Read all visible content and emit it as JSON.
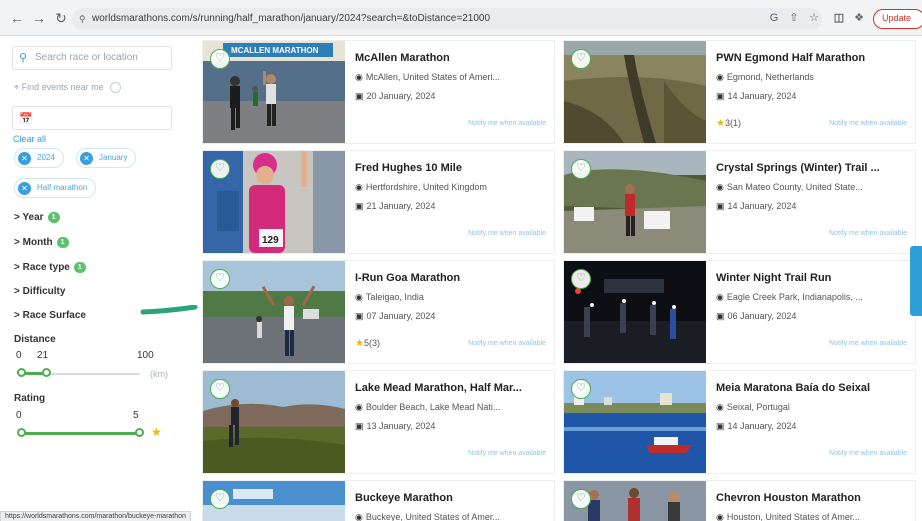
{
  "browser": {
    "url": "worldsmarathons.com/s/running/half_marathon/january/2024?search=&toDistance=21000",
    "update_label": "Update",
    "status_url": "https://worldsmarathons.com/marathon/buckeye-marathon"
  },
  "sidebar": {
    "search_placeholder": "Search race or location",
    "near_me_label": "Find events near me",
    "clear_all": "Clear all",
    "chips": [
      "2024",
      "January",
      "Half marathon"
    ],
    "facets": [
      {
        "label": "Year",
        "badge": "1"
      },
      {
        "label": "Month",
        "badge": "1"
      },
      {
        "label": "Race type",
        "badge": "1"
      },
      {
        "label": "Difficulty",
        "badge": ""
      },
      {
        "label": "Race Surface",
        "badge": ""
      }
    ],
    "distance": {
      "title": "Distance",
      "min": "0",
      "value": "21",
      "max": "100",
      "unit": "(km)",
      "fill_fraction": 0.21
    },
    "rating": {
      "title": "Rating",
      "min": "0",
      "max": "5",
      "low_fraction": 0.0,
      "high_fraction": 1.0
    }
  },
  "cards": [
    {
      "title": "McAllen Marathon",
      "location": "McAllen, United States of Ameri...",
      "date": "20 January, 2024",
      "rating": "",
      "notify": "Notify me when available"
    },
    {
      "title": "PWN Egmond Half Marathon",
      "location": "Egmond, Netherlands",
      "date": "14 January, 2024",
      "rating": "3(1)",
      "notify": "Notify me when available"
    },
    {
      "title": "Fred Hughes 10 Mile",
      "location": "Hertfordshire, United Kingdom",
      "date": "21 January, 2024",
      "rating": "",
      "notify": "Notify me when available"
    },
    {
      "title": "Crystal Springs (Winter) Trail ...",
      "location": "San Mateo County, United State...",
      "date": "14 January, 2024",
      "rating": "",
      "notify": "Notify me when available"
    },
    {
      "title": "I-Run Goa Marathon",
      "location": "Taleigao, India",
      "date": "07 January, 2024",
      "rating": "5(3)",
      "notify": "Notify me when available"
    },
    {
      "title": "Winter Night Trail Run",
      "location": "Eagle Creek Park, Indianapolis, ...",
      "date": "06 January, 2024",
      "rating": "",
      "notify": "Notify me when available"
    },
    {
      "title": "Lake Mead Marathon, Half Mar...",
      "location": "Boulder Beach, Lake Mead Nati...",
      "date": "13 January, 2024",
      "rating": "",
      "notify": "Notify me when available"
    },
    {
      "title": "Meia Maratona Baía do Seixal",
      "location": "Seixal, Portugal",
      "date": "14 January, 2024",
      "rating": "",
      "notify": "Notify me when available"
    },
    {
      "title": "Buckeye Marathon",
      "location": "Buckeye, United States of Amer...",
      "date": "",
      "rating": "",
      "notify": ""
    },
    {
      "title": "Chevron Houston Marathon",
      "location": "Houston, United States of Amer...",
      "date": "",
      "rating": "",
      "notify": ""
    }
  ],
  "photo_banner_text": "MCALLEN MARATHON",
  "bib_number": "129",
  "colors": {
    "accent_blue": "#2e9fd8",
    "accent_green": "#4cae50",
    "star": "#f2b705",
    "update_red": "#d93025"
  }
}
